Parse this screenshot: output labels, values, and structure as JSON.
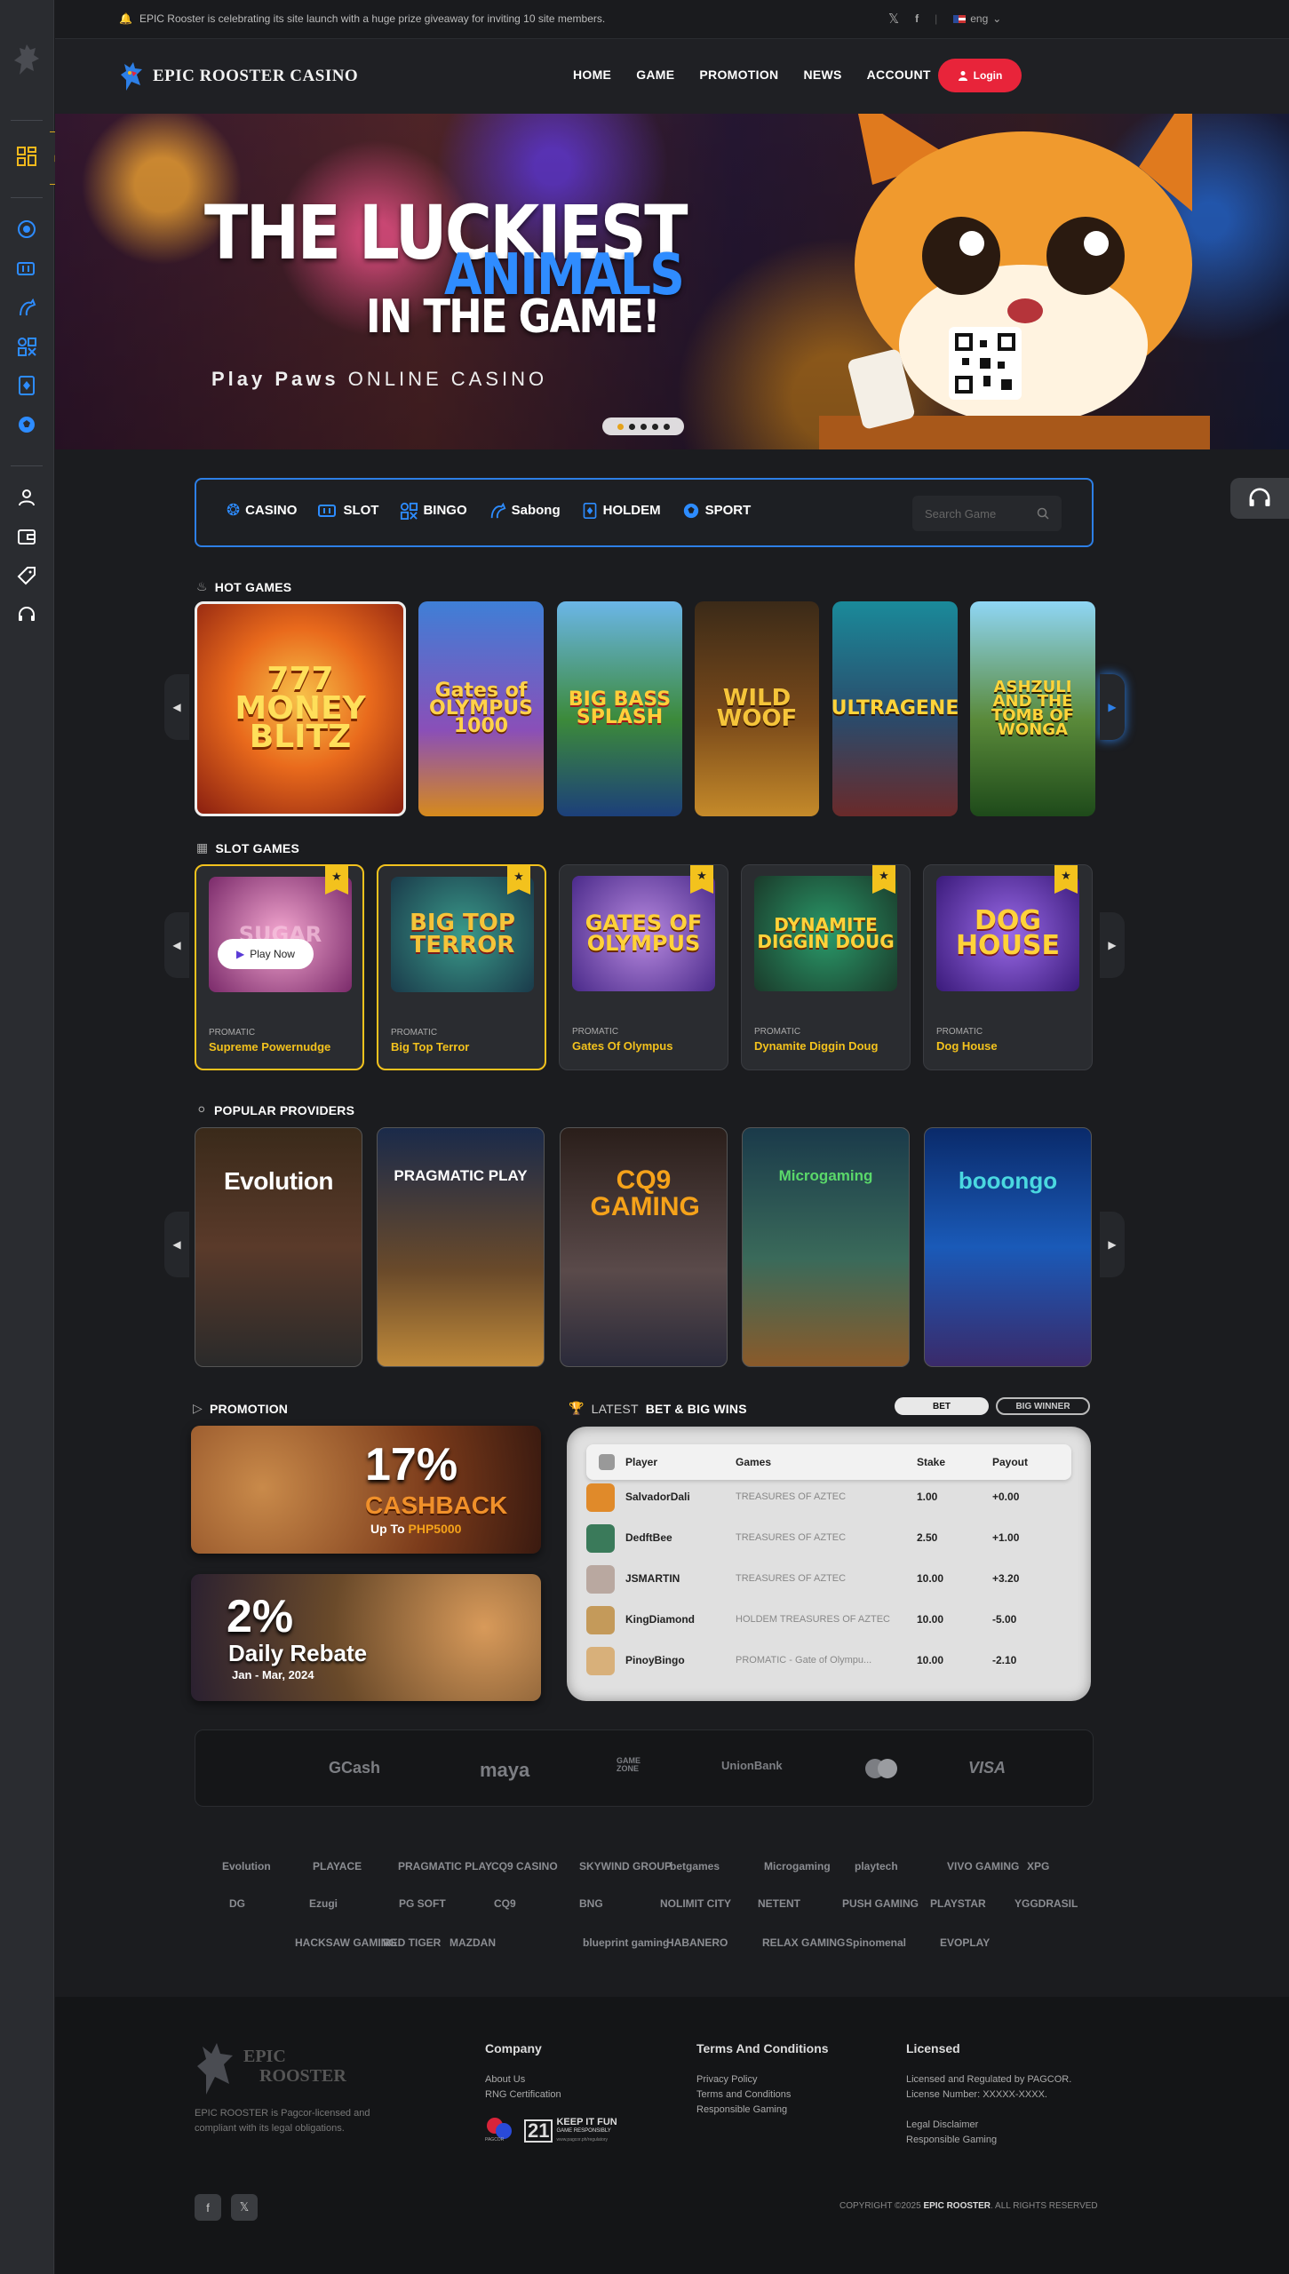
{
  "topbar": {
    "message": "EPIC Rooster is celebrating its site launch with a huge prize giveaway for inviting 10 site members.",
    "language": "eng"
  },
  "brand": {
    "name": "EPIC ROOSTER CASINO"
  },
  "menu": [
    "HOME",
    "GAME",
    "PROMOTION",
    "NEWS",
    "ACCOUNT"
  ],
  "login_label": "Login",
  "hero": {
    "line1": "THE LUCKIEST",
    "line2": "ANIMALS",
    "line3": "IN THE GAME!",
    "sub_bold": "Play Paws",
    "sub_rest": " ONLINE CASINO"
  },
  "categories": [
    "CASINO",
    "SLOT",
    "BINGO",
    "Sabong",
    "HOLDEM",
    "SPORT"
  ],
  "search_placeholder": "Search Game",
  "hot_title": "HOT GAMES",
  "hot_games": [
    {
      "title": "777 MONEY BLITZ"
    },
    {
      "title": "Gates of OLYMPUS 1000"
    },
    {
      "title": "BIG BASS SPLASH"
    },
    {
      "title": "WILD WOOF"
    },
    {
      "title": "ULTRAGENE"
    },
    {
      "title": "ASHZULI AND THE TOMB OF WONGA"
    }
  ],
  "slot_title": "SLOT GAMES",
  "slot_games": [
    {
      "provider": "PROMATIC",
      "name": "Supreme Powernudge",
      "art": "SUGAR",
      "color": "#d86aa6"
    },
    {
      "provider": "PROMATIC",
      "name": "Big Top Terror",
      "art": "BIG TOP TERROR",
      "color": "#d9a02a"
    },
    {
      "provider": "PROMATIC",
      "name": "Gates Of Olympus",
      "art": "GATES OF OLYMPUS",
      "color": "#e8b93a"
    },
    {
      "provider": "PROMATIC",
      "name": "Dynamite Diggin Doug",
      "art": "DYNAMITE DIGGIN DOUG",
      "color": "#e6a32a"
    },
    {
      "provider": "PROMATIC",
      "name": "Dog House",
      "art": "DOG HOUSE",
      "color": "#f4c44a"
    }
  ],
  "play_now": "Play Now",
  "providers_title": "POPULAR PROVIDERS",
  "providers": [
    "Evolution",
    "PRAGMATIC PLAY",
    "CQ9 GAMING",
    "Microgaming",
    "booongo"
  ],
  "promotion_title": "PROMOTION",
  "promos": [
    {
      "big": "17%",
      "label": "CASHBACK",
      "sub_pre": "Up To ",
      "sub_hl": "PHP5000"
    },
    {
      "big": "2%",
      "label": "Daily Rebate",
      "sub_pre": "Jan - Mar, 2024",
      "sub_hl": ""
    }
  ],
  "wins": {
    "title_pre": "LATEST",
    "title_bold": "BET & BIG WINS",
    "tabs": [
      "BET",
      "BIG WINNER"
    ],
    "columns": [
      "Player",
      "Games",
      "Stake",
      "Payout"
    ],
    "rows": [
      {
        "player": "SalvadorDali",
        "game": "TREASURES OF AZTEC",
        "stake": "1.00",
        "payout": "+0.00",
        "color": "#e08a2a"
      },
      {
        "player": "DedftBee",
        "game": "TREASURES OF AZTEC",
        "stake": "2.50",
        "payout": "+1.00",
        "color": "#3a7a5a"
      },
      {
        "player": "JSMARTIN",
        "game": "TREASURES OF AZTEC",
        "stake": "10.00",
        "payout": "+3.20",
        "color": "#b9a8a0"
      },
      {
        "player": "KingDiamond",
        "game": "HOLDEM TREASURES OF AZTEC",
        "stake": "10.00",
        "payout": "-5.00",
        "color": "#c49a5a"
      },
      {
        "player": "PinoyBingo",
        "game": "PROMATIC - Gate of Olympu...",
        "stake": "10.00",
        "payout": "-2.10",
        "color": "#d8b07a"
      }
    ]
  },
  "payments": [
    "GCash",
    "maya",
    "GAME ZONE",
    "UnionBank",
    "mastercard",
    "VISA"
  ],
  "provider_logos": [
    "Evolution",
    "PLAYACE",
    "PRAGMATIC PLAY",
    "CQ9 CASINO",
    "SKYWIND GROUP",
    "betgames",
    "Microgaming",
    "playtech",
    "VIVO GAMING",
    "XPG",
    "DG",
    "Ezugi",
    "PG SOFT",
    "CQ9",
    "BNG",
    "NOLIMIT CITY",
    "NETENT",
    "PUSH GAMING",
    "PLAYSTAR",
    "YGGDRASIL",
    "HACKSAW GAMING",
    "RED TIGER",
    "MAZDAN",
    "blueprint gaming",
    "HABANERO",
    "RELAX GAMING",
    "Spinomenal",
    "EVOPLAY"
  ],
  "footer": {
    "logo_line1": "EPIC",
    "logo_line2": "ROOSTER",
    "about": "EPIC ROOSTER is Pagcor-licensed and compliant with its legal obligations.",
    "company_title": "Company",
    "company_links": [
      "About Us",
      "RNG Certification"
    ],
    "terms_title": "Terms And Conditions",
    "terms_links": [
      "Privacy Policy",
      "Terms and Conditions",
      "Responsible Gaming"
    ],
    "licensed_title": "Licensed",
    "licensed_lines": [
      "Licensed and Regulated by PAGCOR.",
      "License Number: XXXXX-XXXX."
    ],
    "licensed_links": [
      "Legal Disclaimer",
      "Responsible Gaming"
    ],
    "badge1": "PAGCOR",
    "badge2_num": "21",
    "badge2_title": "KEEP IT FUN",
    "badge2_sub": "GAME RESPONSIBLY",
    "badge2_url": "www.pagcor.ph/regulatory",
    "copyright_pre": "COPYRIGHT ©2025 ",
    "copyright_bold": "EPIC ROOSTER",
    "copyright_post": ". ALL RIGHTS RESERVED"
  }
}
